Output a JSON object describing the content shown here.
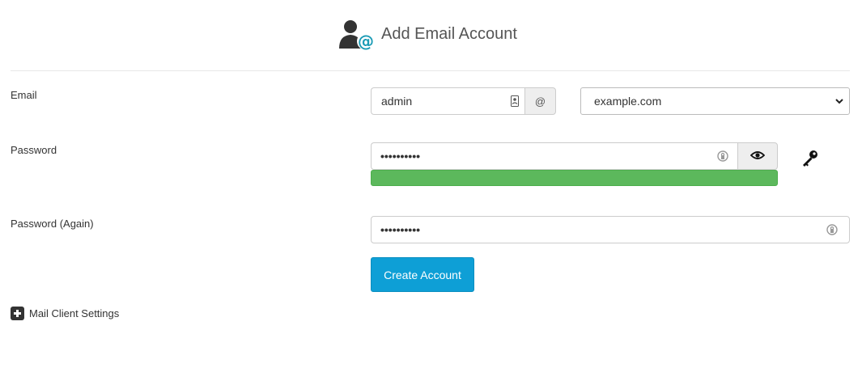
{
  "header": {
    "title": "Add Email Account",
    "icon": "user-at-icon",
    "accent": "#1a9bb5"
  },
  "email": {
    "label": "Email",
    "value": "admin",
    "at_symbol": "@",
    "domain_selected": "example.com"
  },
  "password": {
    "label": "Password",
    "masked_value": "••••••••••",
    "strength_color": "#5cb85c",
    "strength_percent": 100
  },
  "password_again": {
    "label": "Password (Again)",
    "masked_value": "••••••••••"
  },
  "actions": {
    "create_label": "Create Account",
    "create_color": "#0e9fd6"
  },
  "mail_client": {
    "label": "Mail Client Settings"
  }
}
